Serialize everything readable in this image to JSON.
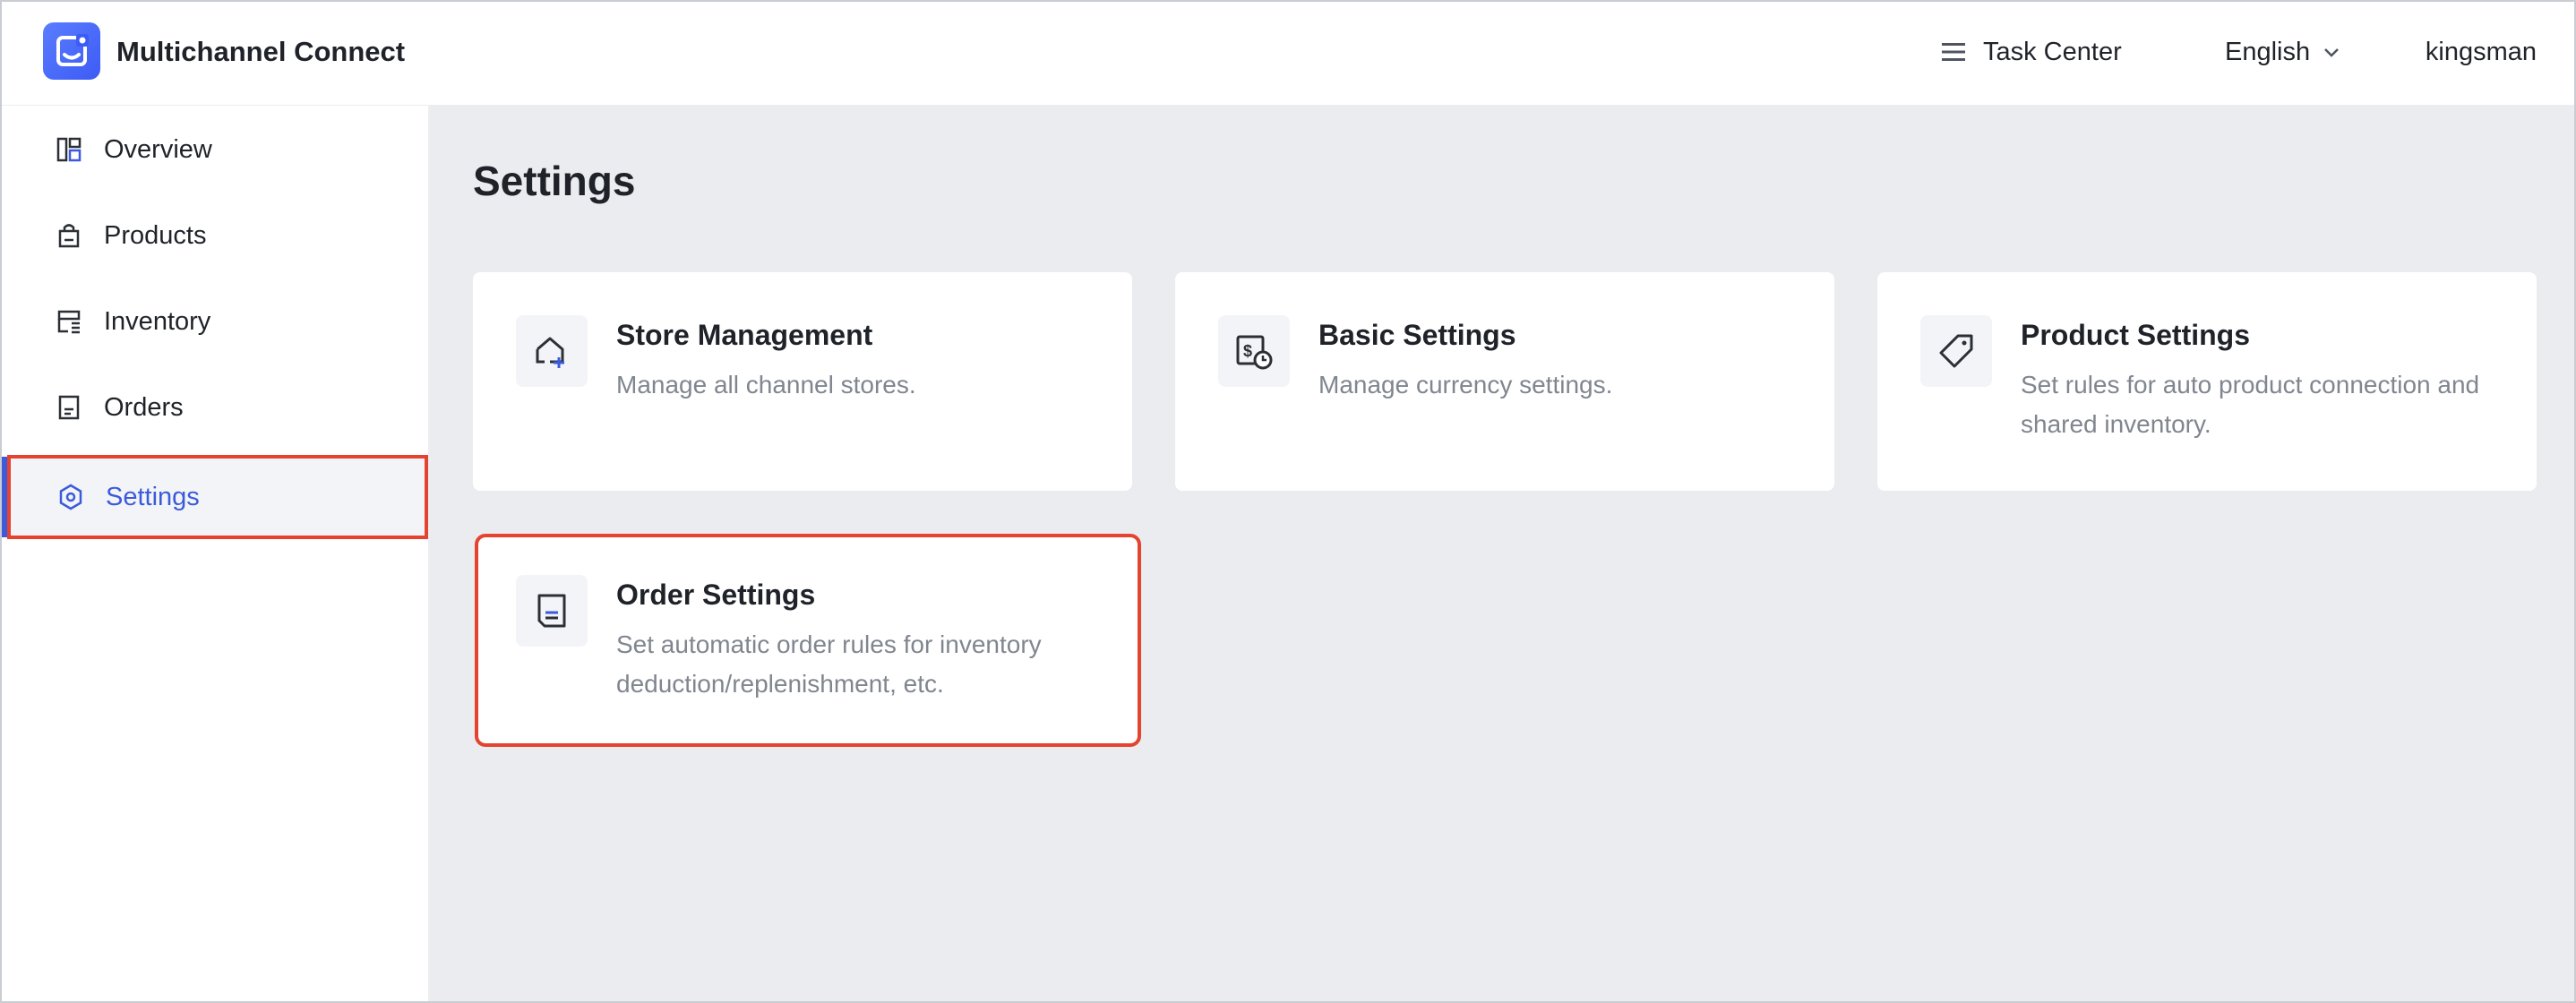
{
  "header": {
    "app_title": "Multichannel Connect",
    "task_center": "Task Center",
    "language": "English",
    "username": "kingsman"
  },
  "sidebar": {
    "items": [
      {
        "label": "Overview",
        "icon": "overview-icon"
      },
      {
        "label": "Products",
        "icon": "shopping-bag-icon"
      },
      {
        "label": "Inventory",
        "icon": "inventory-icon"
      },
      {
        "label": "Orders",
        "icon": "orders-icon"
      },
      {
        "label": "Settings",
        "icon": "settings-icon",
        "active": true
      }
    ]
  },
  "main": {
    "title": "Settings",
    "cards": [
      {
        "title": "Store Management",
        "desc": "Manage all channel stores.",
        "icon": "store-add-icon"
      },
      {
        "title": "Basic Settings",
        "desc": "Manage currency settings.",
        "icon": "currency-icon"
      },
      {
        "title": "Product Settings",
        "desc": "Set rules for auto product connection and shared inventory.",
        "icon": "tag-icon"
      },
      {
        "title": "Order Settings",
        "desc": "Set automatic order rules for inventory deduction/replenishment, etc.",
        "icon": "order-doc-icon"
      }
    ]
  },
  "colors": {
    "accent": "#3b5bdb",
    "highlight": "#e5432f",
    "main_bg": "#ebecf0"
  }
}
